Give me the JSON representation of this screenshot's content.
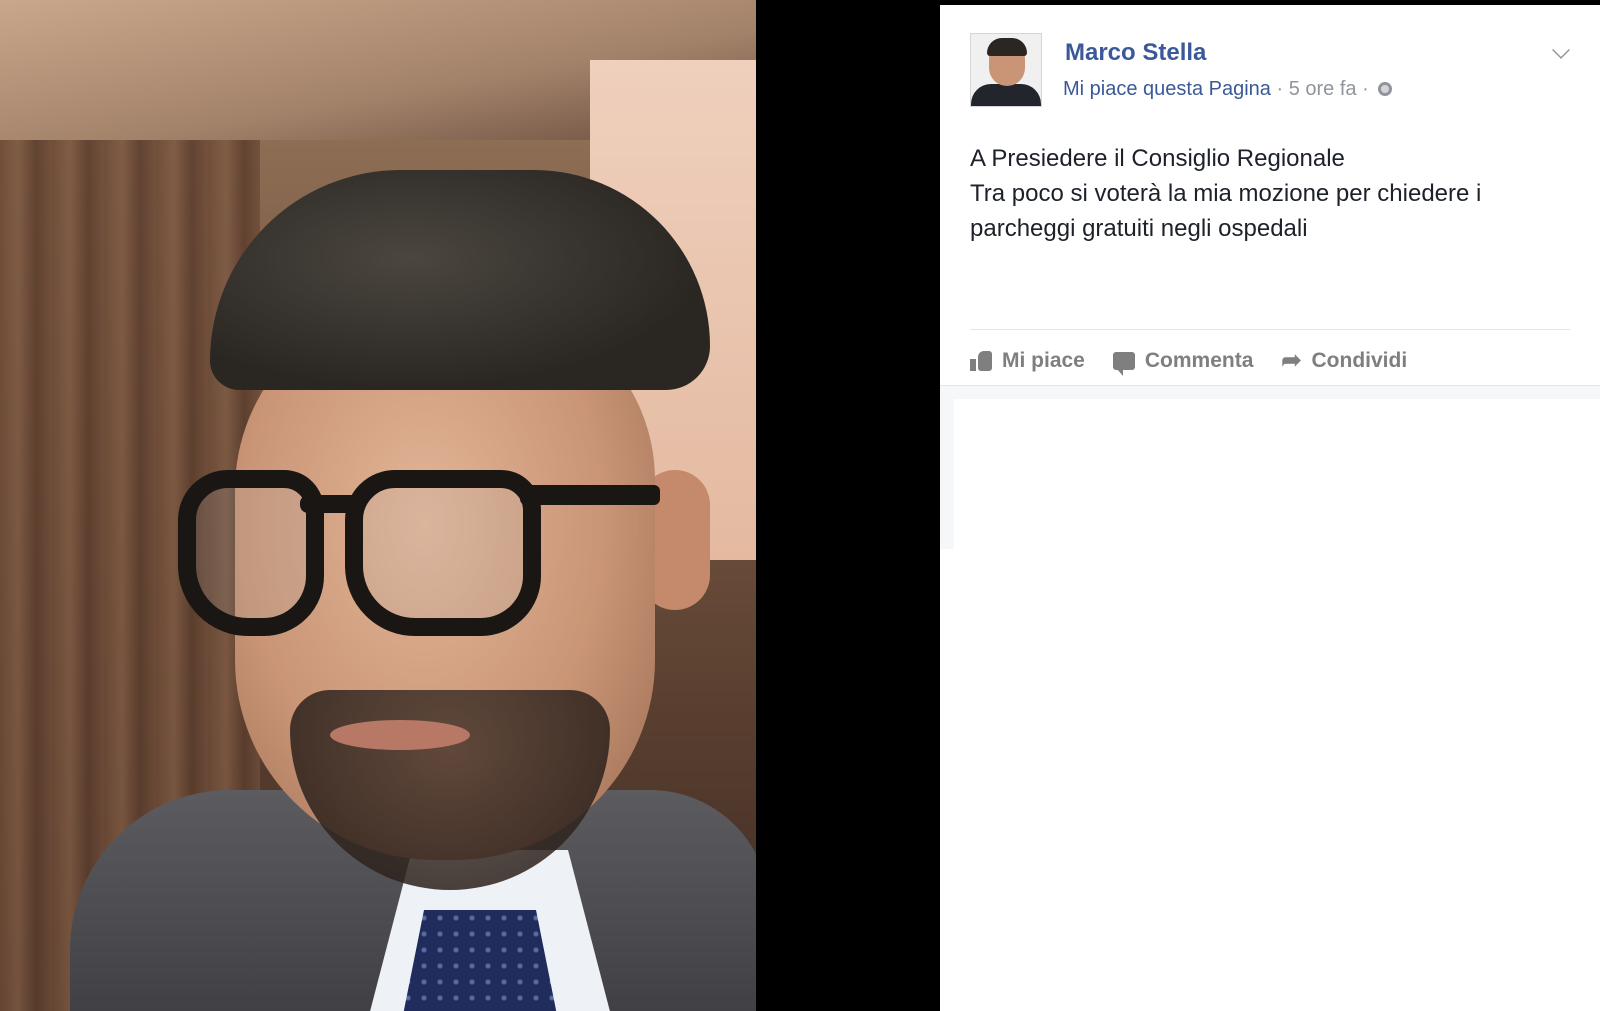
{
  "post": {
    "author": "Marco Stella",
    "like_page": "Mi piace questa Pagina",
    "separator": " · ",
    "time": "5 ore fa",
    "separator2": " · ",
    "text_lines": [
      "A Presiedere il Consiglio Regionale",
      "Tra poco si voterà la mia mozione per chiedere i parcheggi gratuiti negli ospedali"
    ],
    "actions": {
      "like": "Mi piace",
      "comment": "Commenta",
      "share": "Condividi"
    }
  },
  "icons": {
    "like": "thumbs-up-icon",
    "comment": "comment-icon",
    "share": "share-arrow-icon",
    "privacy": "globe-icon",
    "options": "chevron-down-icon"
  },
  "colors": {
    "author_link": "#3b5998",
    "meta_gray": "#90949c",
    "action_gray": "#7f7f7f",
    "text": "#1d2129"
  }
}
